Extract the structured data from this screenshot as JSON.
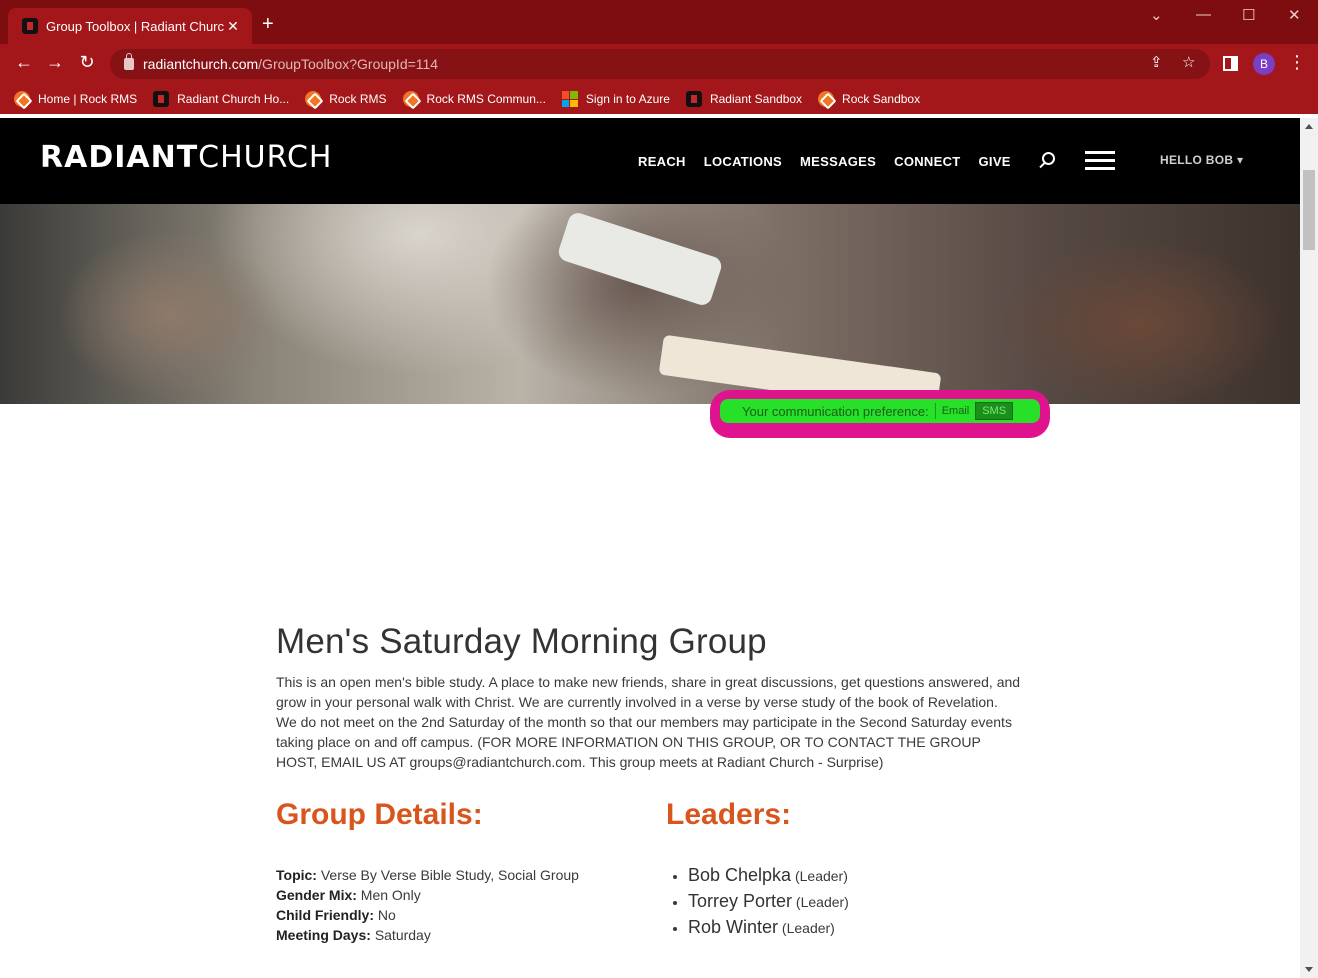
{
  "browser": {
    "tab_title": "Group Toolbox | Radiant Church",
    "new_tab": "+",
    "close_tab": "✕",
    "url_host": "radiantchurch.com",
    "url_path": "/GroupToolbox?GroupId=114",
    "avatar_letter": "B",
    "bookmarks": [
      {
        "label": "Home | Rock RMS",
        "icon": "rock-icon"
      },
      {
        "label": "Radiant Church Ho...",
        "icon": "radiant-icon"
      },
      {
        "label": "Rock RMS",
        "icon": "rock-icon"
      },
      {
        "label": "Rock RMS Commun...",
        "icon": "rock-icon"
      },
      {
        "label": "Sign in to Azure",
        "icon": "microsoft-icon"
      },
      {
        "label": "Radiant Sandbox",
        "icon": "radiant-icon"
      },
      {
        "label": "Rock Sandbox",
        "icon": "rock-icon"
      }
    ]
  },
  "site": {
    "logo_bold": "RADIANT",
    "logo_thin": "CHURCH",
    "nav": [
      "REACH",
      "LOCATIONS",
      "MESSAGES",
      "CONNECT",
      "GIVE"
    ],
    "hello": "HELLO BOB",
    "hello_caret": "▾"
  },
  "preference": {
    "label": "Your communication preference:",
    "email": "Email",
    "sms": "SMS",
    "selected": "SMS"
  },
  "group": {
    "title": "Men's Saturday Morning Group",
    "description": "This is an open men's bible study. A place to make new friends, share in great discussions, get questions answered, and grow in your personal walk with Christ. We are currently involved in a verse by verse study of the book of Revelation. We do not meet on the 2nd Saturday of the month so that our members may participate in the Second Saturday events taking place on and off campus. (FOR MORE INFORMATION ON THIS GROUP, OR TO CONTACT THE GROUP HOST, EMAIL US AT groups@radiantchurch.com. This group meets at Radiant Church - Surprise)",
    "details_heading": "Group Details:",
    "details": [
      {
        "label": "Topic:",
        "value": "Verse By Verse Bible Study, Social Group"
      },
      {
        "label": "Gender Mix:",
        "value": "Men Only"
      },
      {
        "label": "Child Friendly:",
        "value": "No"
      },
      {
        "label": "Meeting Days:",
        "value": "Saturday"
      }
    ],
    "leaders_heading": "Leaders:",
    "leaders": [
      {
        "name": "Bob Chelpka",
        "role": "(Leader)"
      },
      {
        "name": "Torrey Porter",
        "role": "(Leader)"
      },
      {
        "name": "Rob Winter",
        "role": "(Leader)"
      }
    ]
  },
  "colors": {
    "chrome": "#a3171b",
    "accent_orange": "#d8561d",
    "preference_green": "#27e028",
    "highlight_magenta": "#e0138f"
  }
}
